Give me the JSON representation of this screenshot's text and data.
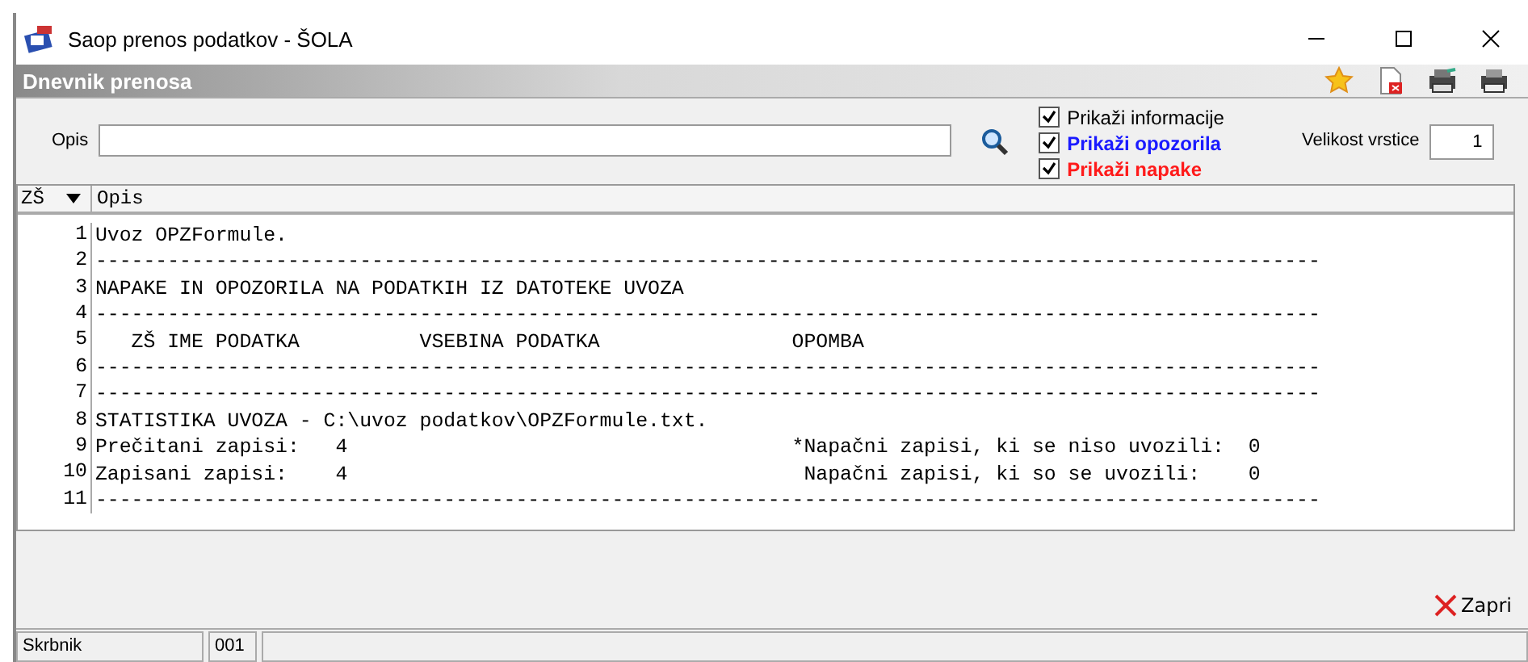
{
  "window": {
    "title": "Saop prenos podatkov - ŠOLA"
  },
  "panel": {
    "title": "Dnevnik prenosa"
  },
  "filter": {
    "label": "Opis",
    "size_label": "Velikost vrstice",
    "size_value": "1"
  },
  "options": [
    {
      "label": "Prikaži informacije",
      "checked": true,
      "color": "#000000"
    },
    {
      "label": "Prikaži opozorila",
      "checked": true,
      "color": "#1a1aff"
    },
    {
      "label": "Prikaži napake",
      "checked": true,
      "color": "#ff1a1a"
    }
  ],
  "table": {
    "columns": [
      "ZŠ",
      "Opis"
    ],
    "rows": [
      {
        "num": "1",
        "text": "Uvoz OPZFormule."
      },
      {
        "num": "2",
        "text": "------------------------------------------------------------------------------------------------------"
      },
      {
        "num": "3",
        "text": "NAPAKE IN OPOZORILA NA PODATKIH IZ DATOTEKE UVOZA"
      },
      {
        "num": "4",
        "text": "------------------------------------------------------------------------------------------------------"
      },
      {
        "num": "5",
        "text": "   ZŠ IME PODATKA          VSEBINA PODATKA                OPOMBA"
      },
      {
        "num": "6",
        "text": "------------------------------------------------------------------------------------------------------"
      },
      {
        "num": "7",
        "text": "------------------------------------------------------------------------------------------------------"
      },
      {
        "num": "8",
        "text": "STATISTIKA UVOZA - C:\\uvoz podatkov\\OPZFormule.txt."
      },
      {
        "num": "9",
        "text": "Prečitani zapisi:   4                                     *Napačni zapisi, ki se niso uvozili:  0"
      },
      {
        "num": "10",
        "text": "Zapisani zapisi:    4                                      Napačni zapisi, ki so se uvozili:    0"
      },
      {
        "num": "11",
        "text": "------------------------------------------------------------------------------------------------------"
      }
    ]
  },
  "buttons": [
    {
      "label": "Zapri"
    }
  ],
  "status_bar": [
    "Skrbnik",
    "001"
  ]
}
